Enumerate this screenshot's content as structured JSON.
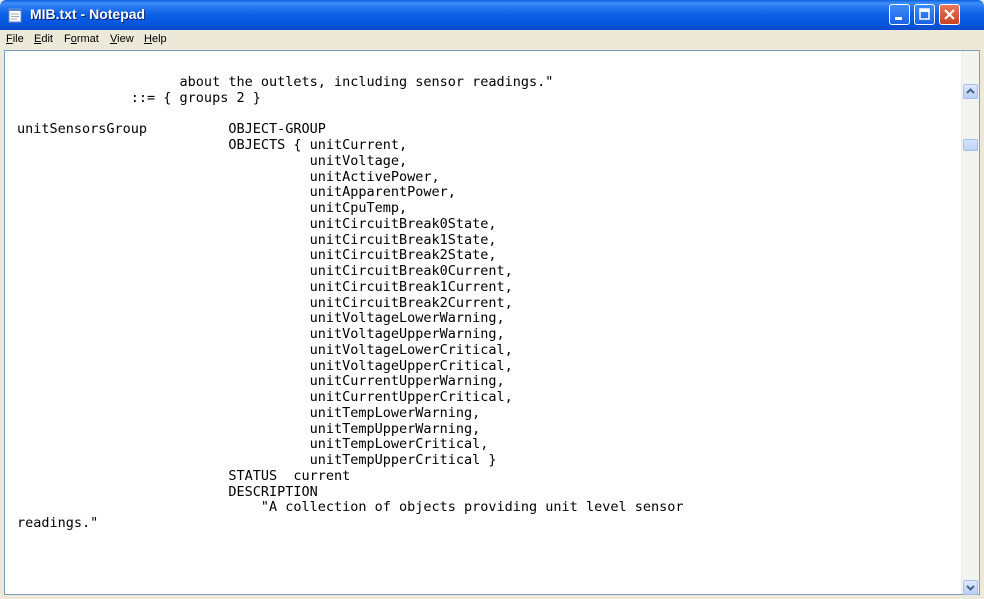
{
  "window": {
    "title": "MIB.txt - Notepad",
    "colors": {
      "titlebar": "#0a5ee0",
      "close": "#c8421f"
    }
  },
  "menu": {
    "file": {
      "u": "F",
      "rest": "ile"
    },
    "edit": {
      "u": "E",
      "rest": "dit"
    },
    "format": {
      "pre": "F",
      "u": "o",
      "rest": "rmat"
    },
    "view": {
      "u": "V",
      "rest": "iew"
    },
    "help": {
      "u": "H",
      "rest": "elp"
    }
  },
  "document": {
    "content": "                    about the outlets, including sensor readings.\"\n              ::= { groups 2 }\n\nunitSensorsGroup          OBJECT-GROUP\n                          OBJECTS { unitCurrent,\n                                    unitVoltage,\n                                    unitActivePower,\n                                    unitApparentPower,\n                                    unitCpuTemp,\n                                    unitCircuitBreak0State,\n                                    unitCircuitBreak1State,\n                                    unitCircuitBreak2State,\n                                    unitCircuitBreak0Current,\n                                    unitCircuitBreak1Current,\n                                    unitCircuitBreak2Current,\n                                    unitVoltageLowerWarning,\n                                    unitVoltageUpperWarning,\n                                    unitVoltageLowerCritical,\n                                    unitVoltageUpperCritical,\n                                    unitCurrentUpperWarning,\n                                    unitCurrentUpperCritical,\n                                    unitTempLowerWarning,\n                                    unitTempUpperWarning,\n                                    unitTempLowerCritical,\n                                    unitTempUpperCritical }\n                          STATUS  current\n                          DESCRIPTION\n                              \"A collection of objects providing unit level sensor\nreadings.\""
  },
  "icons": {
    "app": "notepad-icon",
    "minimize": "minimize-icon",
    "maximize": "maximize-icon",
    "close": "close-icon",
    "scroll_up": "arrow-up-icon",
    "scroll_down": "arrow-down-icon"
  }
}
